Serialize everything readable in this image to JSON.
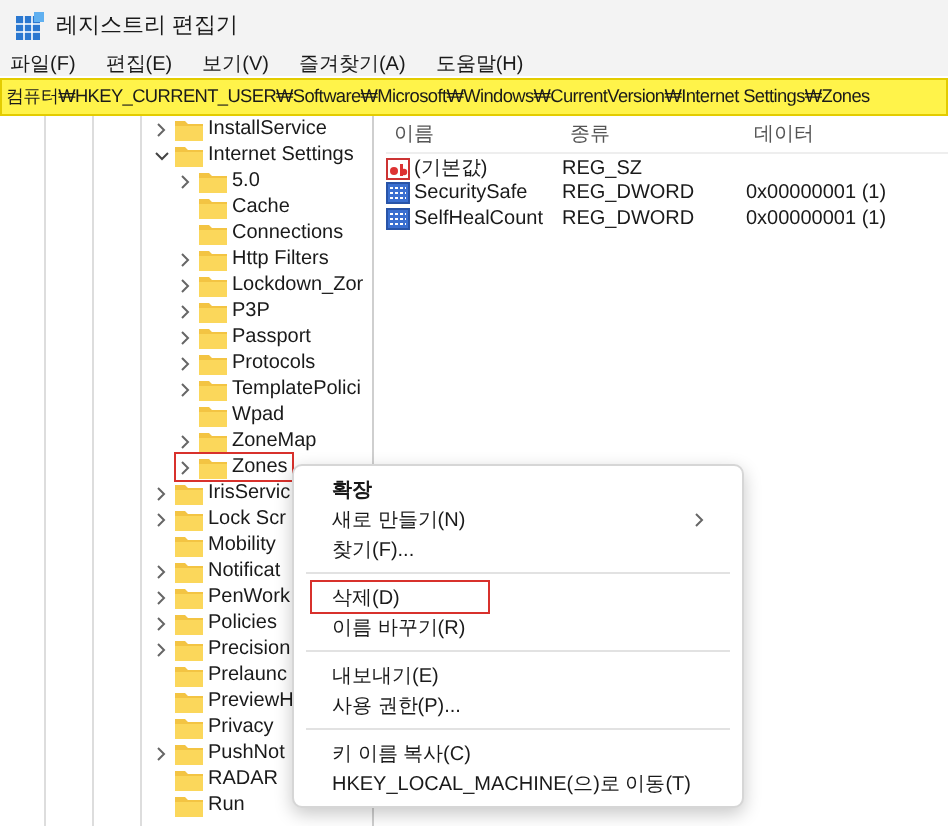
{
  "window": {
    "title": "레지스트리 편집기"
  },
  "menu_bar": [
    "파일(F)",
    "편집(E)",
    "보기(V)",
    "즐겨찾기(A)",
    "도움말(H)"
  ],
  "address_bar": {
    "value": "컴퓨터₩HKEY_CURRENT_USER₩Software₩Microsoft₩Windows₩CurrentVersion₩Internet Settings₩Zones",
    "highlighted": true
  },
  "tree": [
    {
      "label": "InstallService",
      "expandable": true,
      "expanded": false,
      "marked": false
    },
    {
      "label": "Internet Settings",
      "expandable": true,
      "expanded": true,
      "marked": false,
      "children": [
        {
          "label": "5.0",
          "expandable": true,
          "expanded": false,
          "marked": false
        },
        {
          "label": "Cache",
          "expandable": false,
          "expanded": false,
          "marked": false
        },
        {
          "label": "Connections",
          "expandable": false,
          "expanded": false,
          "marked": false
        },
        {
          "label": "Http Filters",
          "expandable": true,
          "expanded": false,
          "marked": false
        },
        {
          "label": "Lockdown_Zor",
          "expandable": true,
          "expanded": false,
          "marked": false
        },
        {
          "label": "P3P",
          "expandable": true,
          "expanded": false,
          "marked": false
        },
        {
          "label": "Passport",
          "expandable": true,
          "expanded": false,
          "marked": false
        },
        {
          "label": "Protocols",
          "expandable": true,
          "expanded": false,
          "marked": false
        },
        {
          "label": "TemplatePolici",
          "expandable": true,
          "expanded": false,
          "marked": false
        },
        {
          "label": "Wpad",
          "expandable": false,
          "expanded": false,
          "marked": false
        },
        {
          "label": "ZoneMap",
          "expandable": true,
          "expanded": false,
          "marked": false
        },
        {
          "label": "Zones",
          "expandable": true,
          "expanded": false,
          "marked": true
        }
      ]
    },
    {
      "label": "IrisServic",
      "expandable": true,
      "expanded": false,
      "marked": false
    },
    {
      "label": "Lock Scr",
      "expandable": true,
      "expanded": false,
      "marked": false
    },
    {
      "label": "Mobility",
      "expandable": false,
      "expanded": false,
      "marked": false
    },
    {
      "label": "Notificat",
      "expandable": true,
      "expanded": false,
      "marked": false
    },
    {
      "label": "PenWork",
      "expandable": true,
      "expanded": false,
      "marked": false
    },
    {
      "label": "Policies",
      "expandable": true,
      "expanded": false,
      "marked": false
    },
    {
      "label": "Precision",
      "expandable": true,
      "expanded": false,
      "marked": false
    },
    {
      "label": "Prelaunc",
      "expandable": false,
      "expanded": false,
      "marked": false
    },
    {
      "label": "PreviewH",
      "expandable": false,
      "expanded": false,
      "marked": false
    },
    {
      "label": "Privacy",
      "expandable": false,
      "expanded": false,
      "marked": false
    },
    {
      "label": "PushNot",
      "expandable": true,
      "expanded": false,
      "marked": false
    },
    {
      "label": "RADAR",
      "expandable": false,
      "expanded": false,
      "marked": false
    },
    {
      "label": "Run",
      "expandable": false,
      "expanded": false,
      "marked": false
    }
  ],
  "values_list": {
    "columns": [
      "이름",
      "종류",
      "데이터"
    ],
    "rows": [
      {
        "kind": "string",
        "name": "(기본값)",
        "type": "REG_SZ",
        "data": ""
      },
      {
        "kind": "dword",
        "name": "SecuritySafe",
        "type": "REG_DWORD",
        "data": "0x00000001 (1)"
      },
      {
        "kind": "dword",
        "name": "SelfHealCount",
        "type": "REG_DWORD",
        "data": "0x00000001 (1)"
      }
    ]
  },
  "context_menu": [
    {
      "kind": "item",
      "label": "확장",
      "default": true,
      "submenu": false,
      "marked": false
    },
    {
      "kind": "item",
      "label": "새로 만들기(N)",
      "default": false,
      "submenu": true,
      "marked": false
    },
    {
      "kind": "item",
      "label": "찾기(F)...",
      "default": false,
      "submenu": false,
      "marked": false
    },
    {
      "kind": "separator"
    },
    {
      "kind": "item",
      "label": "삭제(D)",
      "default": false,
      "submenu": false,
      "marked": true
    },
    {
      "kind": "item",
      "label": "이름 바꾸기(R)",
      "default": false,
      "submenu": false,
      "marked": false
    },
    {
      "kind": "separator"
    },
    {
      "kind": "item",
      "label": "내보내기(E)",
      "default": false,
      "submenu": false,
      "marked": false
    },
    {
      "kind": "item",
      "label": "사용 권한(P)...",
      "default": false,
      "submenu": false,
      "marked": false
    },
    {
      "kind": "separator"
    },
    {
      "kind": "item",
      "label": "키 이름 복사(C)",
      "default": false,
      "submenu": false,
      "marked": false
    },
    {
      "kind": "item",
      "label": "HKEY_LOCAL_MACHINE(으)로 이동(T)",
      "default": false,
      "submenu": false,
      "marked": false
    }
  ]
}
